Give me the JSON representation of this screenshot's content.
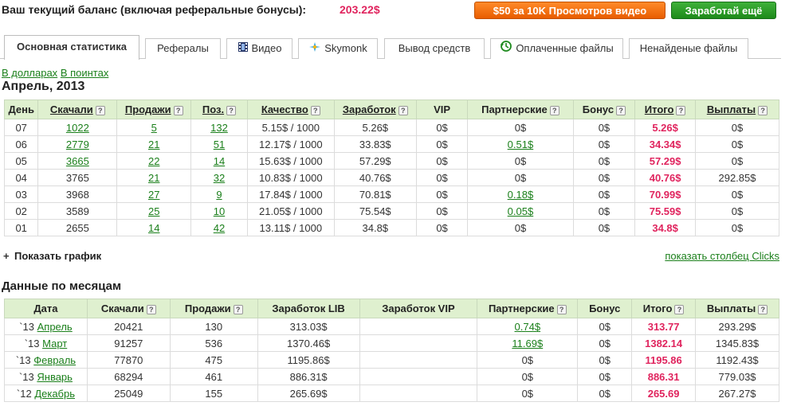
{
  "header": {
    "balance_label": "Ваш текущий баланс (включая реферальные бонусы):",
    "balance_value": "203.22$",
    "promo_button": "$50 за 10K Просмотров видео",
    "earn_button": "Заработай ещё"
  },
  "tabs": [
    {
      "label": "Основная статистика",
      "active": true
    },
    {
      "label": "Рефералы"
    },
    {
      "label": "Видео",
      "icon": "film-icon"
    },
    {
      "label": "Skymonk",
      "icon": "skymonk-icon"
    },
    {
      "label": "Вывод средств"
    },
    {
      "label": "Оплаченные файлы",
      "icon": "history-icon"
    },
    {
      "label": "Ненайденые файлы"
    }
  ],
  "units": {
    "dollars": "В долларах",
    "points": "В поинтах"
  },
  "month_title": "Апрель, 2013",
  "daily": {
    "headers": [
      "День",
      "Скачали",
      "Продажи",
      "Поз.",
      "Качество",
      "Заработок",
      "VIP",
      "Партнерские",
      "Бонус",
      "Итого",
      "Выплаты"
    ],
    "rows": [
      [
        "07",
        "1022",
        "5",
        "132",
        "5.15$ / 1000",
        "5.26$",
        "0$",
        "0$",
        "0$",
        "5.26$",
        "0$"
      ],
      [
        "06",
        "2779",
        "21",
        "51",
        "12.17$ / 1000",
        "33.83$",
        "0$",
        "0.51$",
        "0$",
        "34.34$",
        "0$"
      ],
      [
        "05",
        "3665",
        "22",
        "14",
        "15.63$ / 1000",
        "57.29$",
        "0$",
        "0$",
        "0$",
        "57.29$",
        "0$"
      ],
      [
        "04",
        "3765",
        "21",
        "32",
        "10.83$ / 1000",
        "40.76$",
        "0$",
        "0$",
        "0$",
        "40.76$",
        "292.85$"
      ],
      [
        "03",
        "3968",
        "27",
        "9",
        "17.84$ / 1000",
        "70.81$",
        "0$",
        "0.18$",
        "0$",
        "70.99$",
        "0$"
      ],
      [
        "02",
        "3589",
        "25",
        "10",
        "21.05$ / 1000",
        "75.54$",
        "0$",
        "0.05$",
        "0$",
        "75.59$",
        "0$"
      ],
      [
        "01",
        "2655",
        "14",
        "42",
        "13.11$ / 1000",
        "34.8$",
        "0$",
        "0$",
        "0$",
        "34.8$",
        "0$"
      ]
    ]
  },
  "show_graph": "Показать график",
  "show_clicks": "показать столбец Clicks",
  "monthly_title": "Данные по месяцам",
  "monthly": {
    "headers": [
      "Дата",
      "Скачали",
      "Продажи",
      "Заработок LIB",
      "Заработок VIP",
      "Партнерские",
      "Бонус",
      "Итого",
      "Выплаты"
    ],
    "rows": [
      [
        "`13",
        "Апрель",
        "20421",
        "130",
        "313.03$",
        "",
        "0.74$",
        "0$",
        "313.77",
        "293.29$"
      ],
      [
        "`13",
        "Март",
        "91257",
        "536",
        "1370.46$",
        "",
        "11.69$",
        "0$",
        "1382.14",
        "1345.83$"
      ],
      [
        "`13",
        "Февраль",
        "77870",
        "475",
        "1195.86$",
        "",
        "0$",
        "0$",
        "1195.86",
        "1192.43$"
      ],
      [
        "`13",
        "Январь",
        "68294",
        "461",
        "886.31$",
        "",
        "0$",
        "0$",
        "886.31",
        "779.03$"
      ],
      [
        "`12",
        "Декабрь",
        "25049",
        "155",
        "265.69$",
        "",
        "0$",
        "0$",
        "265.69",
        "267.27$"
      ]
    ]
  },
  "colors": {
    "accent_total": "#e0245e",
    "link": "#1a7f1a",
    "header_bg": "#dff0cf",
    "promo": "#f07010",
    "earn": "#259a22"
  }
}
